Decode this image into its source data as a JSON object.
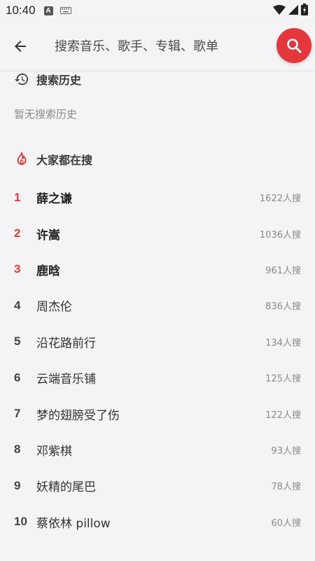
{
  "status_bar": {
    "time": "10:40",
    "notif_letter": "A"
  },
  "search": {
    "placeholder": "搜索音乐、歌手、专辑、歌单",
    "value": ""
  },
  "history": {
    "title": "搜索历史",
    "empty_text": "暂无搜索历史"
  },
  "hot": {
    "title": "大家都在搜",
    "items": [
      {
        "rank": "1",
        "name": "薛之谦",
        "count": "1622人搜"
      },
      {
        "rank": "2",
        "name": "许嵩",
        "count": "1036人搜"
      },
      {
        "rank": "3",
        "name": "鹿晗",
        "count": "961人搜"
      },
      {
        "rank": "4",
        "name": "周杰伦",
        "count": "836人搜"
      },
      {
        "rank": "5",
        "name": "沿花路前行",
        "count": "134人搜"
      },
      {
        "rank": "6",
        "name": "云端音乐铺",
        "count": "125人搜"
      },
      {
        "rank": "7",
        "name": "梦的翅膀受了伤",
        "count": "122人搜"
      },
      {
        "rank": "8",
        "name": "邓紫棋",
        "count": "93人搜"
      },
      {
        "rank": "9",
        "name": "妖精的尾巴",
        "count": "78人搜"
      },
      {
        "rank": "10",
        "name": "蔡依林 pillow",
        "count": "60人搜"
      }
    ]
  },
  "colors": {
    "accent": "#e5373b",
    "background": "#f4f4f7",
    "rank_top": "#e23b3b"
  },
  "icons": {
    "back": "arrow-left-icon",
    "search": "search-icon",
    "history": "history-icon",
    "hot": "flame-icon",
    "wifi": "wifi-icon",
    "signal": "signal-icon",
    "battery": "battery-icon",
    "keyboard": "keyboard-icon"
  }
}
